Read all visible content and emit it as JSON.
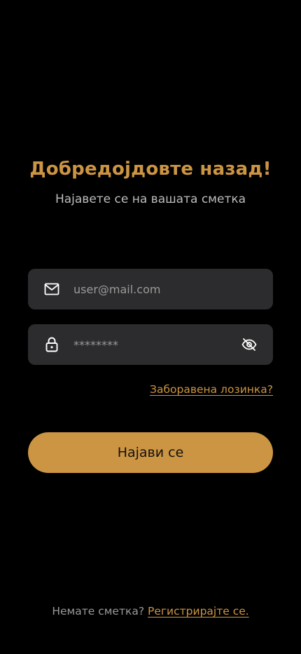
{
  "header": {
    "title": "Добредојдовте назад!",
    "subtitle": "Најавете се на вашата сметка"
  },
  "form": {
    "email": {
      "placeholder": "user@mail.com",
      "value": "",
      "icon": "mail-icon"
    },
    "password": {
      "placeholder": "********",
      "value": "",
      "icon": "lock-icon",
      "toggle_icon": "eye-off-icon"
    },
    "forgot_password_label": "Заборавена лозинка?",
    "submit_label": "Најави се"
  },
  "footer": {
    "prompt": "Немате сметка?",
    "register_label": "Регистрирајте се."
  },
  "colors": {
    "background": "#000000",
    "accent": "#cc9543",
    "field_background": "#2c2c2e",
    "placeholder": "#9a9a9a"
  }
}
